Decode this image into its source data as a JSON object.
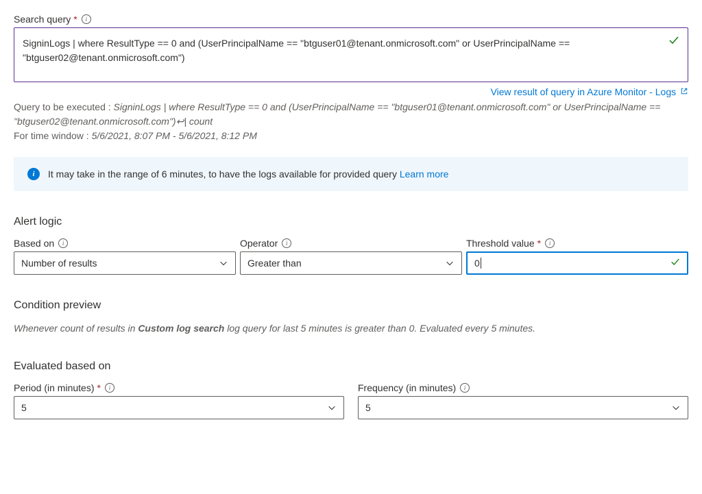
{
  "search": {
    "label": "Search query",
    "value": "SigninLogs | where ResultType == 0 and (UserPrincipalName == \"btguser01@tenant.onmicrosoft.com\" or UserPrincipalName == \"btguser02@tenant.onmicrosoft.com\")"
  },
  "view_link": "View result of query in Azure Monitor - Logs",
  "preview": {
    "prefix": "Query to be executed : ",
    "query": "SigninLogs | where ResultType == 0 and (UserPrincipalName == \"btguser01@tenant.onmicrosoft.com\" or UserPrincipalName == \"btguser02@tenant.onmicrosoft.com\")↩| count",
    "window_prefix": "For time window : ",
    "window_value": "5/6/2021, 8:07 PM - 5/6/2021, 8:12 PM"
  },
  "banner": {
    "text": "It may take in the range of 6 minutes, to have the logs available for provided query",
    "learn_more": "Learn more"
  },
  "sections": {
    "alert_logic": "Alert logic",
    "condition_preview": "Condition preview",
    "evaluated": "Evaluated based on"
  },
  "alert": {
    "based_on": {
      "label": "Based on",
      "value": "Number of results"
    },
    "operator": {
      "label": "Operator",
      "value": "Greater than"
    },
    "threshold": {
      "label": "Threshold value",
      "value": "0"
    }
  },
  "condition": {
    "pre": "Whenever count of results in ",
    "bold": "Custom log search",
    "post": " log query for last 5 minutes is greater than 0. Evaluated every 5 minutes."
  },
  "evaluated": {
    "period": {
      "label": "Period (in minutes)",
      "value": "5"
    },
    "frequency": {
      "label": "Frequency (in minutes)",
      "value": "5"
    }
  }
}
